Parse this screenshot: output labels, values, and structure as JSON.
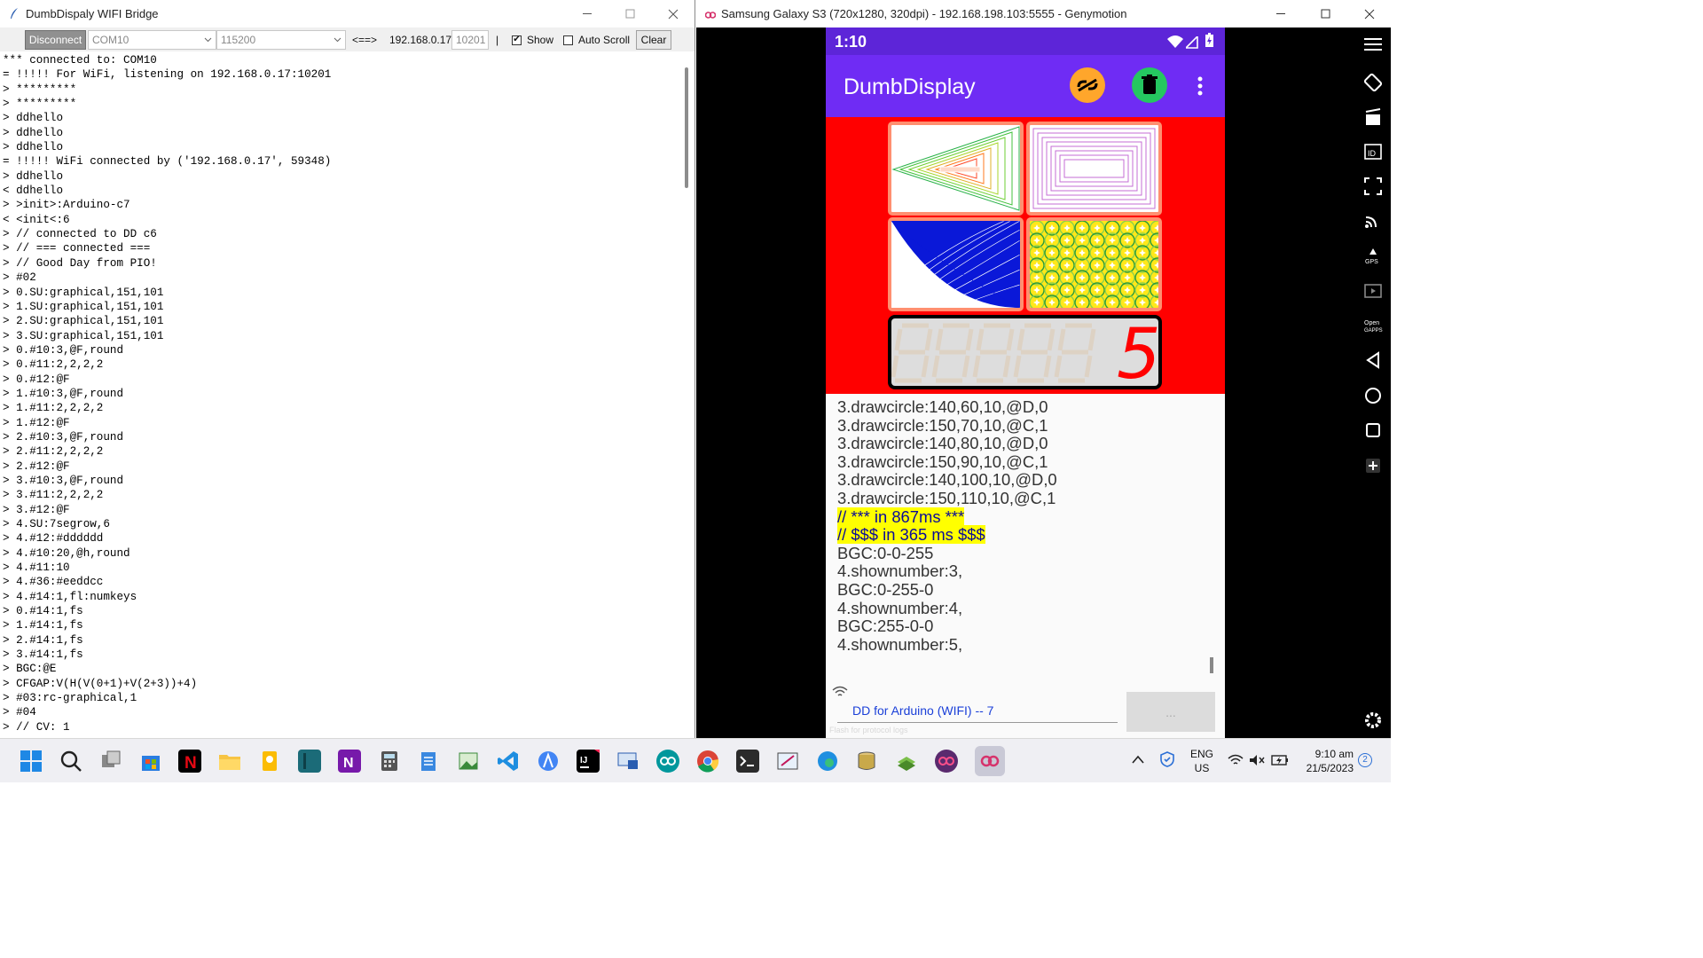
{
  "bridge": {
    "title": "DumbDispaly WIFI Bridge",
    "disconnect_label": "Disconnect",
    "port_value": "COM10",
    "baud_value": "115200",
    "arrow_label": "<==>",
    "ip_label": "192.168.0.17:",
    "port_field": "10201",
    "sep": "|",
    "show_label": "Show",
    "show_checked": "✔",
    "autoscroll_label": "Auto Scroll",
    "clear_label": "Clear",
    "log": [
      "*** connected to: COM10",
      "= !!!!! For WiFi, listening on 192.168.0.17:10201",
      "> *********",
      "> *********",
      "> ddhello",
      "> ddhello",
      "> ddhello",
      "= !!!!! WiFi connected by ('192.168.0.17', 59348)",
      "> ddhello",
      "< ddhello",
      "> >init>:Arduino-c7",
      "< <init<:6",
      "> // connected to DD c6",
      "> // === connected ===",
      "> // Good Day from PIO!",
      "> #02",
      "> 0.SU:graphical,151,101",
      "> 1.SU:graphical,151,101",
      "> 2.SU:graphical,151,101",
      "> 3.SU:graphical,151,101",
      "> 0.#10:3,@F,round",
      "> 0.#11:2,2,2,2",
      "> 0.#12:@F",
      "> 1.#10:3,@F,round",
      "> 1.#11:2,2,2,2",
      "> 1.#12:@F",
      "> 2.#10:3,@F,round",
      "> 2.#11:2,2,2,2",
      "> 2.#12:@F",
      "> 3.#10:3,@F,round",
      "> 3.#11:2,2,2,2",
      "> 3.#12:@F",
      "> 4.SU:7segrow,6",
      "> 4.#12:#dddddd",
      "> 4.#10:20,@h,round",
      "> 4.#11:10",
      "> 4.#36:#eeddcc",
      "> 4.#14:1,fl:numkeys",
      "> 0.#14:1,fs",
      "> 1.#14:1,fs",
      "> 2.#14:1,fs",
      "> 3.#14:1,fs",
      "> BGC:@E",
      "> CFGAP:V(H(V(0+1)+V(2+3))+4)",
      "> #03:rc-graphical,1",
      "> #04",
      "> // CV: 1"
    ]
  },
  "emulator": {
    "title": "Samsung Galaxy S3 (720x1280, 320dpi) - 192.168.198.103:5555 - Genymotion",
    "time": "1:10",
    "app_name": "DumbDisplay",
    "seven_seg_digit": "5",
    "lines": [
      "3.drawcircle:140,60,10,@D,0",
      "3.drawcircle:150,70,10,@C,1",
      "3.drawcircle:140,80,10,@D,0",
      "3.drawcircle:150,90,10,@C,1",
      "3.drawcircle:140,100,10,@D,0",
      "3.drawcircle:150,110,10,@C,1",
      "// *** in 867ms ***",
      "// $$$ in 365 ms $$$",
      "BGC:0-0-255",
      "4.shownumber:3,",
      "BGC:0-255-0",
      "4.shownumber:4,",
      "BGC:255-0-0",
      "4.shownumber:5,"
    ],
    "connection_label": "DD for Arduino (WIFI) -- 7",
    "send_button": "...",
    "hint": "Flash for protocol logs"
  },
  "taskbar": {
    "lang_top": "ENG",
    "lang_bottom": "US",
    "clock_time": "9:10 am",
    "clock_date": "21/5/2023",
    "notif_count": "2"
  },
  "colors": {
    "appbar": "#6f2cf4",
    "statusbar": "#5d25d8",
    "canvas_bg": "#ff0000",
    "tile_border": "#ff8f70",
    "highlight": "#ffff00",
    "link_blue": "#1a3fd8"
  }
}
